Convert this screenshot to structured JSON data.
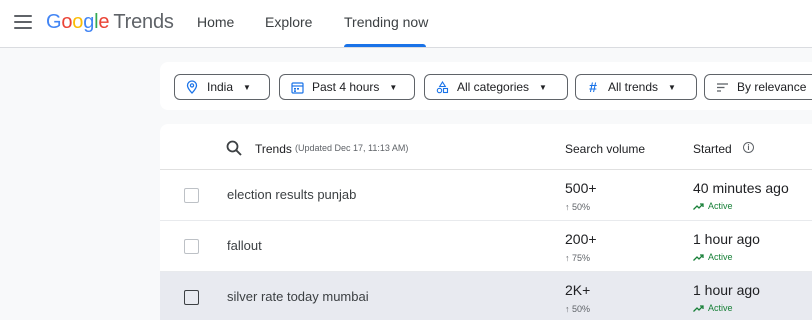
{
  "app": {
    "logo_google": [
      "G",
      "o",
      "o",
      "g",
      "l",
      "e"
    ],
    "logo_trends": "Trends"
  },
  "nav": {
    "tabs": [
      {
        "label": "Home"
      },
      {
        "label": "Explore"
      },
      {
        "label": "Trending now",
        "active": true
      }
    ]
  },
  "filters": [
    {
      "label": "India",
      "icon": "location-pin-icon"
    },
    {
      "label": "Past 4 hours",
      "icon": "calendar-icon"
    },
    {
      "label": "All categories",
      "icon": "category-shapes-icon"
    },
    {
      "label": "All trends",
      "icon": "hash-icon"
    },
    {
      "label": "By relevance",
      "icon": "sort-icon"
    }
  ],
  "table": {
    "header": {
      "trends": "Trends",
      "updated": "(Updated Dec 17, 11:13 AM)",
      "search_volume": "Search volume",
      "started": "Started",
      "info_icon": "ⓘ"
    },
    "rows": [
      {
        "name": "election results punjab",
        "volume": "500+",
        "change": "↑ 50%",
        "started": "40 minutes ago",
        "status": "Active"
      },
      {
        "name": "fallout",
        "volume": "200+",
        "change": "↑ 75%",
        "started": "1 hour ago",
        "status": "Active"
      },
      {
        "name": "silver rate today mumbai",
        "volume": "2K+",
        "change": "↑ 50%",
        "started": "1 hour ago",
        "status": "Active"
      }
    ]
  },
  "colors": {
    "accent": "#1a73e8",
    "active_green": "#188038",
    "highlight_row": "#e8eaf0"
  }
}
